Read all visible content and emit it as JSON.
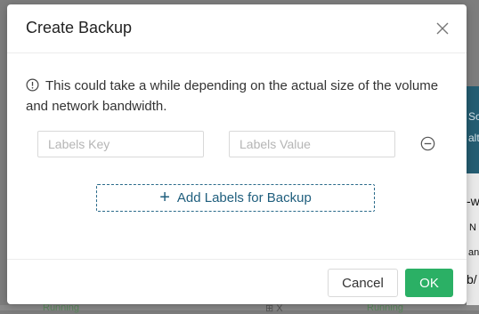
{
  "background": {
    "teal_text_1": "Sc",
    "teal_text_2": "alt",
    "text_1": "-w",
    "text_2": "N",
    "text_3": "an",
    "text_4": "b/",
    "bottom_left": "Running",
    "bottom_mid": "⊞ X",
    "bottom_right": "Running"
  },
  "dialog": {
    "title": "Create Backup",
    "info_text": "This could take a while depending on the actual size of the volume and network bandwidth.",
    "labels_key_placeholder": "Labels Key",
    "labels_value_placeholder": "Labels Value",
    "labels_key_value": "",
    "labels_value_value": "",
    "add_labels_label": "Add Labels for Backup",
    "cancel_label": "Cancel",
    "ok_label": "OK"
  },
  "icons": {
    "close": "close-icon",
    "info": "info-circle-icon",
    "remove": "minus-circle-icon",
    "add": "plus-icon"
  },
  "colors": {
    "ok_button": "#2bb065",
    "add_button_text": "#1f5e7d",
    "overlay": "#7d7d7d"
  }
}
